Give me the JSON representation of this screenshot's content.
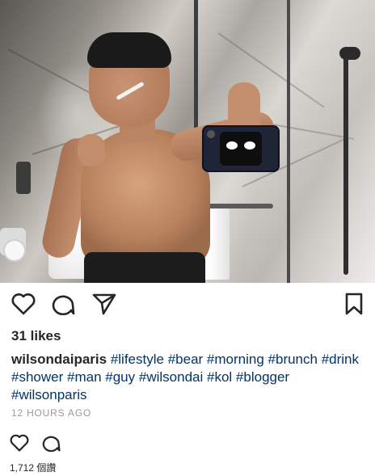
{
  "post": {
    "likes": "31 likes",
    "username": "wilsondaiparis",
    "hashtags": [
      "#lifestyle",
      "#bear",
      "#morning",
      "#brunch",
      "#drink",
      "#shower",
      "#man",
      "#guy",
      "#wilsondai",
      "#kol",
      "#blogger",
      "#wilsonparis"
    ],
    "timestamp": "12 HOURS AGO"
  },
  "secondary": {
    "views": "1,712 個讚"
  },
  "icons": {
    "like": "heart-icon",
    "comment": "comment-icon",
    "share": "send-icon",
    "save": "bookmark-icon"
  },
  "colors": {
    "text": "#262626",
    "hashtag": "#003569",
    "muted": "#999999"
  }
}
